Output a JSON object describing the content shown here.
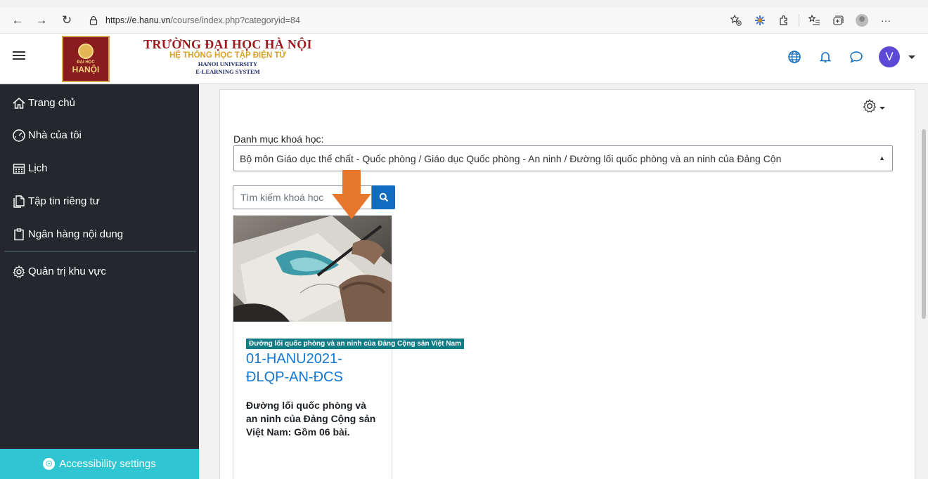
{
  "browser": {
    "url_host": "https://e.hanu.vn",
    "url_path": "/course/index.php?categoryid=84",
    "menu_label": "···"
  },
  "header": {
    "logo_line1": "ĐẠI HỌC",
    "logo_line2": "HANỘI",
    "brand_title": "TRƯỜNG ĐẠI HỌC HÀ NỘI",
    "brand_subtitle": "HỆ THỐNG HỌC TẬP ĐIỆN TỬ",
    "brand_en1": "HANOI UNIVERSITY",
    "brand_en2": "E-LEARNING SYSTEM",
    "avatar_initial": "V"
  },
  "sidebar": {
    "items": [
      {
        "label": "Trang chủ",
        "icon": "home-icon"
      },
      {
        "label": "Nhà của tôi",
        "icon": "dashboard-icon"
      },
      {
        "label": "Lịch",
        "icon": "calendar-icon"
      },
      {
        "label": "Tập tin riêng tư",
        "icon": "files-icon"
      },
      {
        "label": "Ngân hàng nội dung",
        "icon": "clipboard-icon"
      },
      {
        "label": "Quản trị khu vực",
        "icon": "gear-icon"
      }
    ],
    "accessibility_label": "Accessibility settings"
  },
  "main": {
    "category_label": "Danh mục khoá học:",
    "category_selected": "Bộ môn Giáo dục thể chất - Quốc phòng / Giáo dục Quốc phòng - An ninh / Đường lối quốc phòng và an ninh của Đảng Cộn",
    "search_placeholder": "Tìm kiếm khoá học",
    "course": {
      "tag": "Đường lối quốc phòng và an ninh của Đảng Cộng sản Việt Nam",
      "title": "01-HANU2021-ĐLQP-AN-ĐCS",
      "summary": "Đường lối quốc phòng và an ninh của Đảng Cộng sản Việt Nam: Gồm 06 bài."
    }
  },
  "colors": {
    "sidebar_bg": "#24282d",
    "accessibility_bg": "#2fc5d2",
    "link_blue": "#1177d1",
    "search_button": "#0f6cbf",
    "course_tag_bg": "#117c86",
    "annotation_arrow": "#e8772e",
    "avatar_bg": "#5d49d6"
  }
}
